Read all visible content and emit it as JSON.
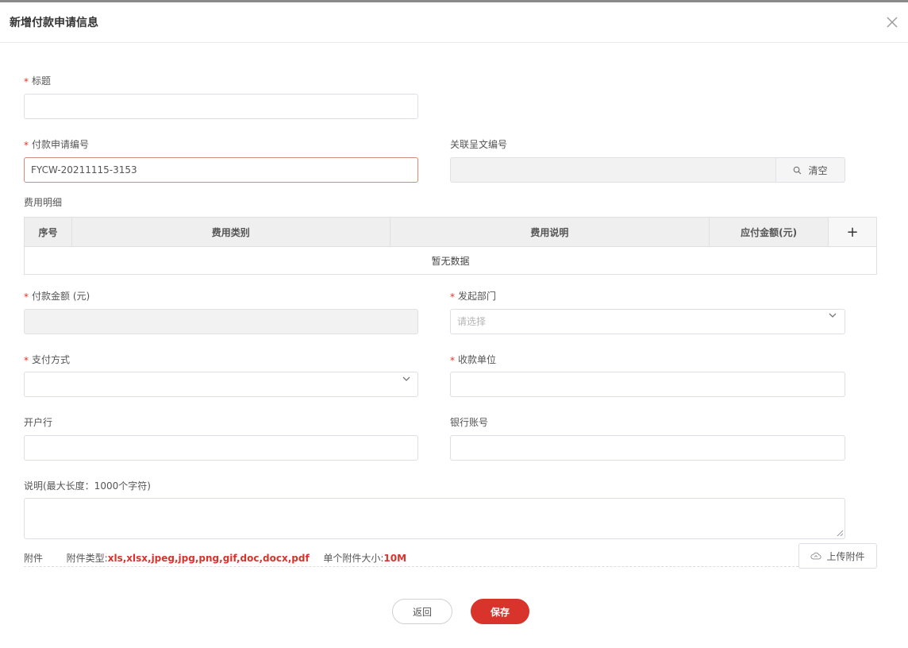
{
  "dialog": {
    "title": "新增付款申请信息"
  },
  "icons": {
    "close": "close-icon",
    "search": "search-icon",
    "chevron": "chevron-down-icon",
    "upload": "cloud-upload-icon"
  },
  "colors": {
    "accent": "#d9342b",
    "required": "#d9342b"
  },
  "form": {
    "title": {
      "label": "标题",
      "required": "*",
      "value": ""
    },
    "payment_no": {
      "label": "付款申请编号",
      "required": "*",
      "value": "FYCW-20211115-3153"
    },
    "related_doc_no": {
      "label": "关联呈文编号",
      "value": "",
      "clear_label": "清空"
    },
    "expense_detail": {
      "label": "费用明细",
      "columns": [
        "序号",
        "费用类别",
        "费用说明",
        "应付金额(元)"
      ],
      "add_label": "+",
      "empty_text": "暂无数据"
    },
    "payment_amount": {
      "label": "付款金额 (元)",
      "required": "*",
      "value": ""
    },
    "department": {
      "label": "发起部门",
      "required": "*",
      "placeholder": "请选择"
    },
    "payment_method": {
      "label": "支付方式",
      "required": "*",
      "value": ""
    },
    "payee": {
      "label": "收款单位",
      "required": "*",
      "value": ""
    },
    "bank": {
      "label": "开户行",
      "value": ""
    },
    "account": {
      "label": "银行账号",
      "value": ""
    },
    "remark": {
      "label": "说明(最大长度：1000个字符)",
      "value": ""
    },
    "attachment": {
      "label": "附件",
      "types_prefix": "附件类型:",
      "types": "xls,xlsx,jpeg,jpg,png,gif,doc,docx,pdf",
      "size_prefix": "单个附件大小:",
      "size": "10M",
      "upload_label": "上传附件"
    }
  },
  "buttons": {
    "back": "返回",
    "save": "保存"
  }
}
